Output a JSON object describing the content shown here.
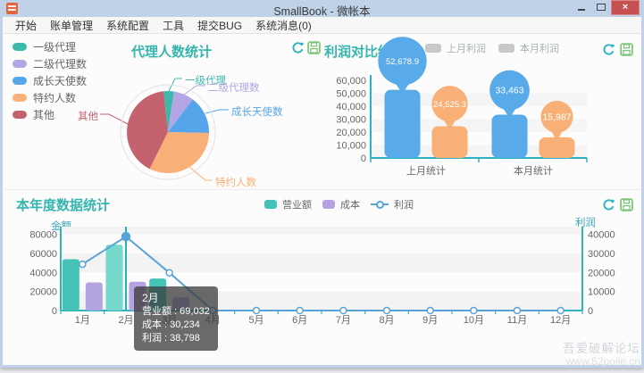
{
  "window": {
    "title": "SmallBook - 微帐本",
    "close_glyph": "×"
  },
  "menu": {
    "items": [
      "开始",
      "账单管理",
      "系统配置",
      "工具",
      "提交BUG",
      "系统消息(0)"
    ]
  },
  "watermark": {
    "line1": "吾爱破解论坛",
    "line2": "www.52pojie.cn"
  },
  "colors": {
    "title_teal": "#35b5ae",
    "axis_teal": "#2fb3c0",
    "refresh_icon": "#2fb3c0",
    "save_icon": "#7cc576",
    "close_button_red": "#c75050"
  },
  "chart_data": [
    {
      "type": "pie",
      "title": "代理人数统计",
      "legend_position": "left",
      "labels": [
        "一级代理",
        "二级代理数",
        "成长天使数",
        "特约人数",
        "其他"
      ],
      "values_percent": [
        4,
        8,
        15,
        32,
        41
      ],
      "colors": [
        "#3db9ab",
        "#b4a5e4",
        "#55a5ea",
        "#f9b078",
        "#c4636d"
      ]
    },
    {
      "type": "bar",
      "title": "利润对比统计",
      "categories": [
        "上月统计",
        "本月统计"
      ],
      "legend": [
        "上月利润",
        "本月利润"
      ],
      "legend_marker_color": "#c9c9c9",
      "legend_text_color": "#a3b5ac",
      "series": [
        {
          "name": "blue-series",
          "color": "#58aae8",
          "values": [
            52678.9,
            33463
          ],
          "labels": [
            "52,678.9",
            "33,463"
          ]
        },
        {
          "name": "orange-series",
          "color": "#f9b077",
          "values": [
            24525.3,
            15987
          ],
          "labels": [
            "24,525.3",
            "15,987"
          ]
        }
      ],
      "ylim": [
        0,
        60000
      ],
      "ytick_step": 10000,
      "grid_bands": true
    },
    {
      "type": "bar+line",
      "title": "本年度数据统计",
      "categories": [
        "1月",
        "2月",
        "3月",
        "4月",
        "5月",
        "6月",
        "7月",
        "8月",
        "9月",
        "10月",
        "11月",
        "12月"
      ],
      "series": [
        {
          "name": "营业额",
          "type": "bar",
          "color": "#44c2b6",
          "highlight": "#76d7cb",
          "values": [
            53800,
            69032,
            33600,
            0,
            0,
            0,
            0,
            0,
            0,
            0,
            0,
            0
          ]
        },
        {
          "name": "成本",
          "type": "bar",
          "color": "#b3a3e1",
          "values": [
            29500,
            30234,
            13800,
            0,
            0,
            0,
            0,
            0,
            0,
            0,
            0,
            0
          ]
        },
        {
          "name": "利润",
          "type": "line",
          "color": "#58a4d8",
          "yaxis": "right",
          "values": [
            24300,
            38798,
            19800,
            0,
            0,
            0,
            0,
            0,
            0,
            0,
            0,
            0
          ]
        }
      ],
      "left_axis": {
        "label": "金额",
        "ticks": [
          0,
          20000,
          40000,
          60000,
          80000
        ],
        "max": 88000
      },
      "right_axis": {
        "label": "利润",
        "ticks": [
          0,
          10000,
          20000,
          30000,
          40000
        ],
        "max": 44000
      },
      "highlight_index": 1,
      "tooltip": {
        "title": "2月",
        "lines": [
          "营业额 : 69,032",
          "成本 : 30,234",
          "利润 : 38,798"
        ]
      }
    }
  ]
}
